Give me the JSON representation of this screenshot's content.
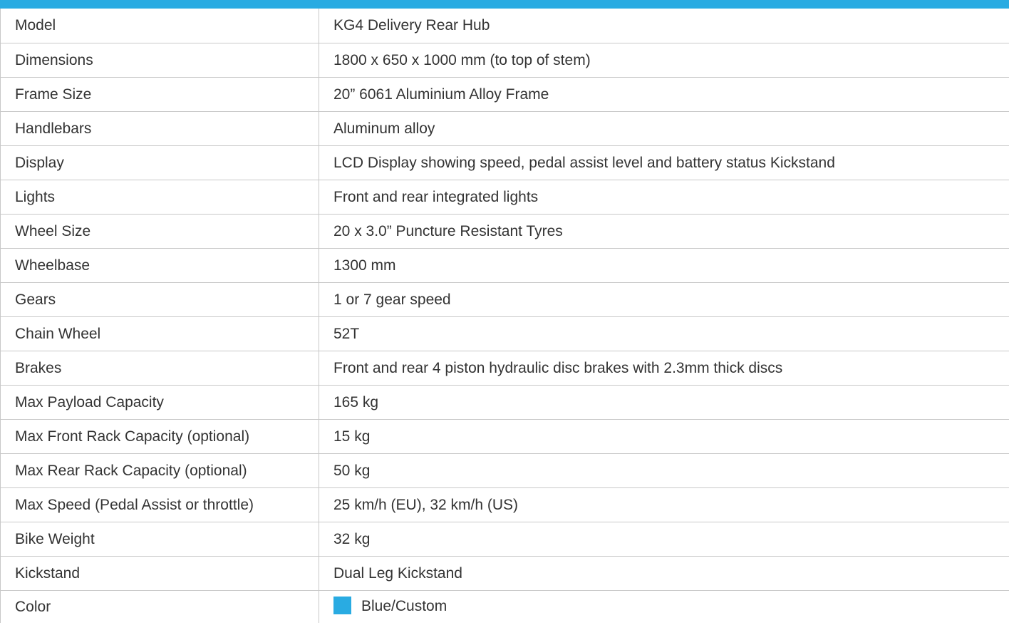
{
  "accent_color": "#29abe2",
  "specs": [
    {
      "label": "Model",
      "value": "KG4 Delivery Rear Hub"
    },
    {
      "label": "Dimensions",
      "value": "1800 x 650 x 1000 mm (to top of stem)"
    },
    {
      "label": "Frame Size",
      "value": "20” 6061 Aluminium Alloy Frame"
    },
    {
      "label": "Handlebars",
      "value": "Aluminum alloy"
    },
    {
      "label": "Display",
      "value": "LCD Display showing speed,  pedal assist level and battery status Kickstand"
    },
    {
      "label": "Lights",
      "value": "Front and rear integrated lights"
    },
    {
      "label": "Wheel Size",
      "value": "20 x 3.0” Puncture Resistant Tyres"
    },
    {
      "label": "Wheelbase",
      "value": "1300 mm"
    },
    {
      "label": "Gears",
      "value": "1 or 7 gear speed"
    },
    {
      "label": "Chain Wheel",
      "value": "52T"
    },
    {
      "label": "Brakes",
      "value": "Front and rear 4 piston hydraulic disc brakes with 2.3mm thick discs"
    },
    {
      "label": "Max Payload Capacity",
      "value": "165 kg"
    },
    {
      "label": "Max Front Rack Capacity (optional)",
      "value": "15 kg"
    },
    {
      "label": "Max Rear Rack Capacity (optional)",
      "value": "50 kg"
    },
    {
      "label": "Max Speed (Pedal Assist or throttle)",
      "value": "25 km/h (EU), 32 km/h (US)"
    },
    {
      "label": "Bike Weight",
      "value": "32 kg"
    },
    {
      "label": "Kickstand",
      "value": "Dual Leg Kickstand"
    },
    {
      "label": "Color",
      "value": "Blue/Custom",
      "swatch_color": "#29abe2"
    }
  ]
}
